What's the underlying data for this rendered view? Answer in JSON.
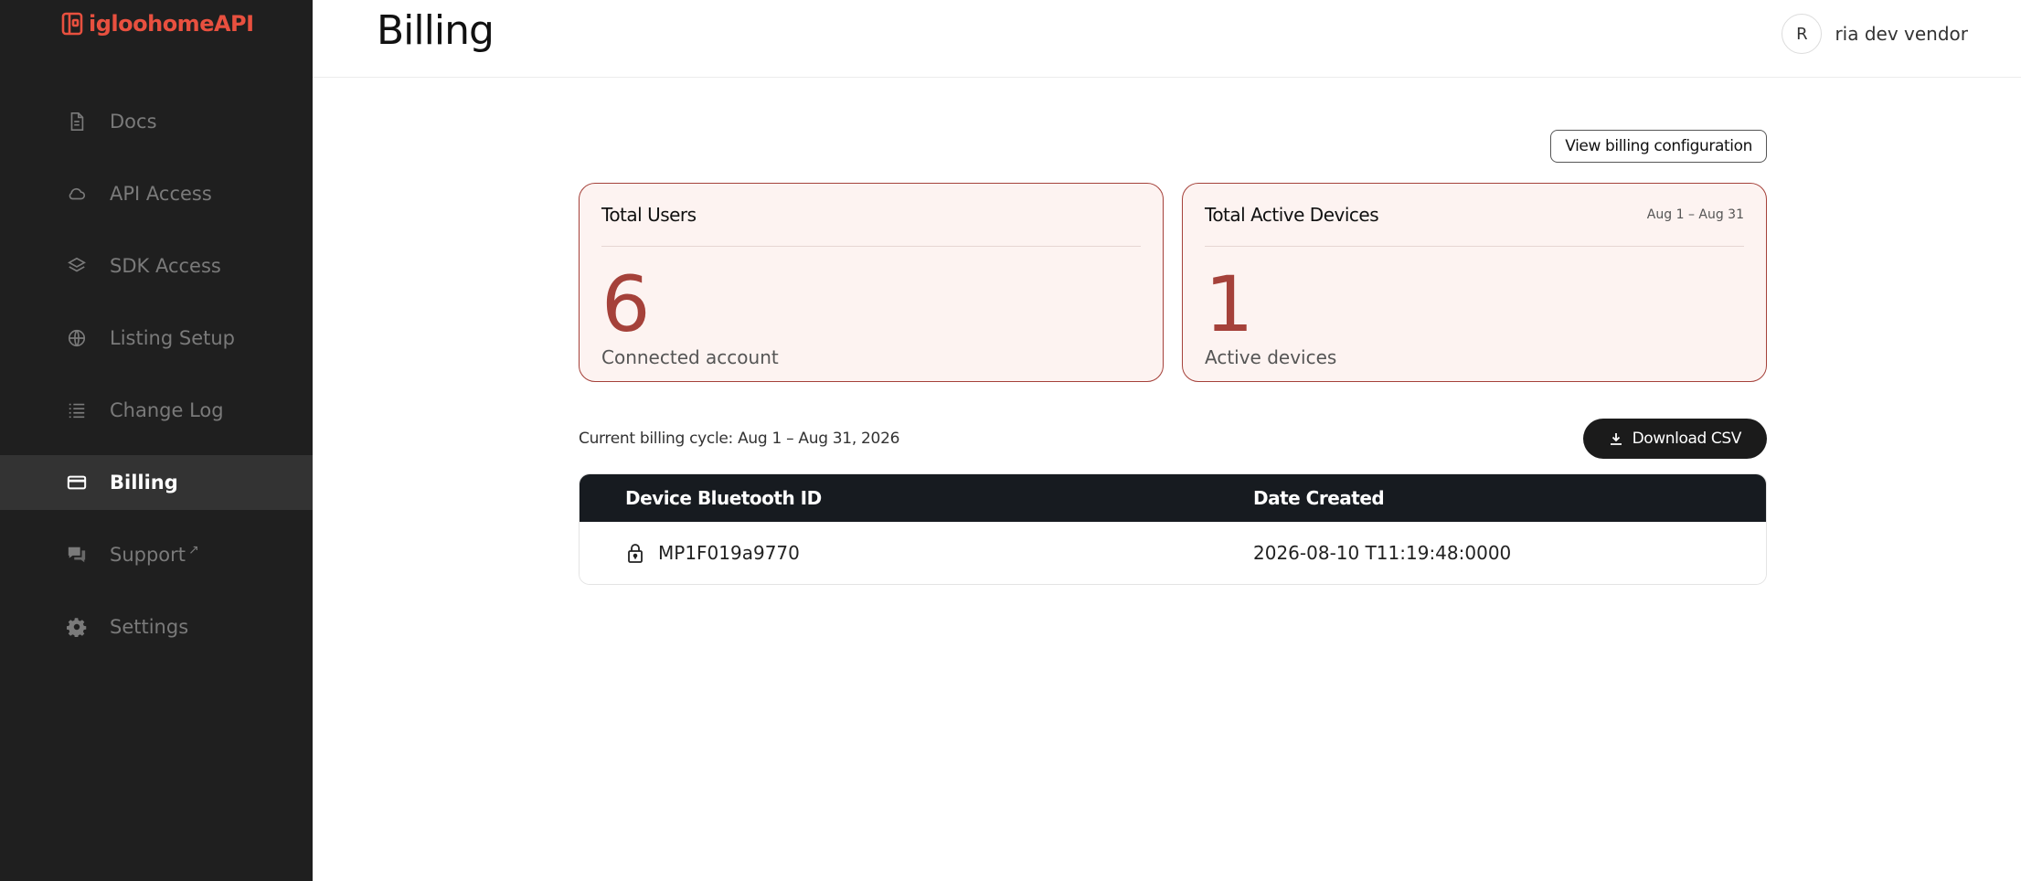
{
  "app": {
    "logo_text": "igloohomeAPI",
    "brand_color": "#e8503f",
    "accent_color": "#a5413a"
  },
  "sidebar": {
    "items": [
      {
        "label": "Docs",
        "icon": "document-icon",
        "active": false
      },
      {
        "label": "API Access",
        "icon": "cloud-icon",
        "active": false
      },
      {
        "label": "SDK Access",
        "icon": "layers-icon",
        "active": false
      },
      {
        "label": "Listing Setup",
        "icon": "globe-icon",
        "active": false
      },
      {
        "label": "Change Log",
        "icon": "list-icon",
        "active": false
      },
      {
        "label": "Billing",
        "icon": "credit-card-icon",
        "active": true
      },
      {
        "label": "Support",
        "icon": "chat-icon",
        "active": false,
        "external": true
      },
      {
        "label": "Settings",
        "icon": "gear-icon",
        "active": false
      }
    ]
  },
  "header": {
    "title": "Billing",
    "user_initial": "R",
    "user_name": "ria dev vendor"
  },
  "main": {
    "config_button": "View billing configuration",
    "cards": [
      {
        "title": "Total Users",
        "range": "",
        "value": "6",
        "caption": "Connected account"
      },
      {
        "title": "Total Active Devices",
        "range": "Aug 1 – Aug 31",
        "value": "1",
        "caption": "Active devices"
      }
    ],
    "cycle_text": "Current billing cycle: Aug 1 – Aug 31, 2026",
    "download_button": "Download CSV",
    "table": {
      "columns": [
        "Device Bluetooth ID",
        "Date Created"
      ],
      "rows": [
        {
          "device_id": "MP1F019a9770",
          "date_created": "2026-08-10 T11:19:48:0000",
          "icon": "lock-icon"
        }
      ]
    }
  }
}
